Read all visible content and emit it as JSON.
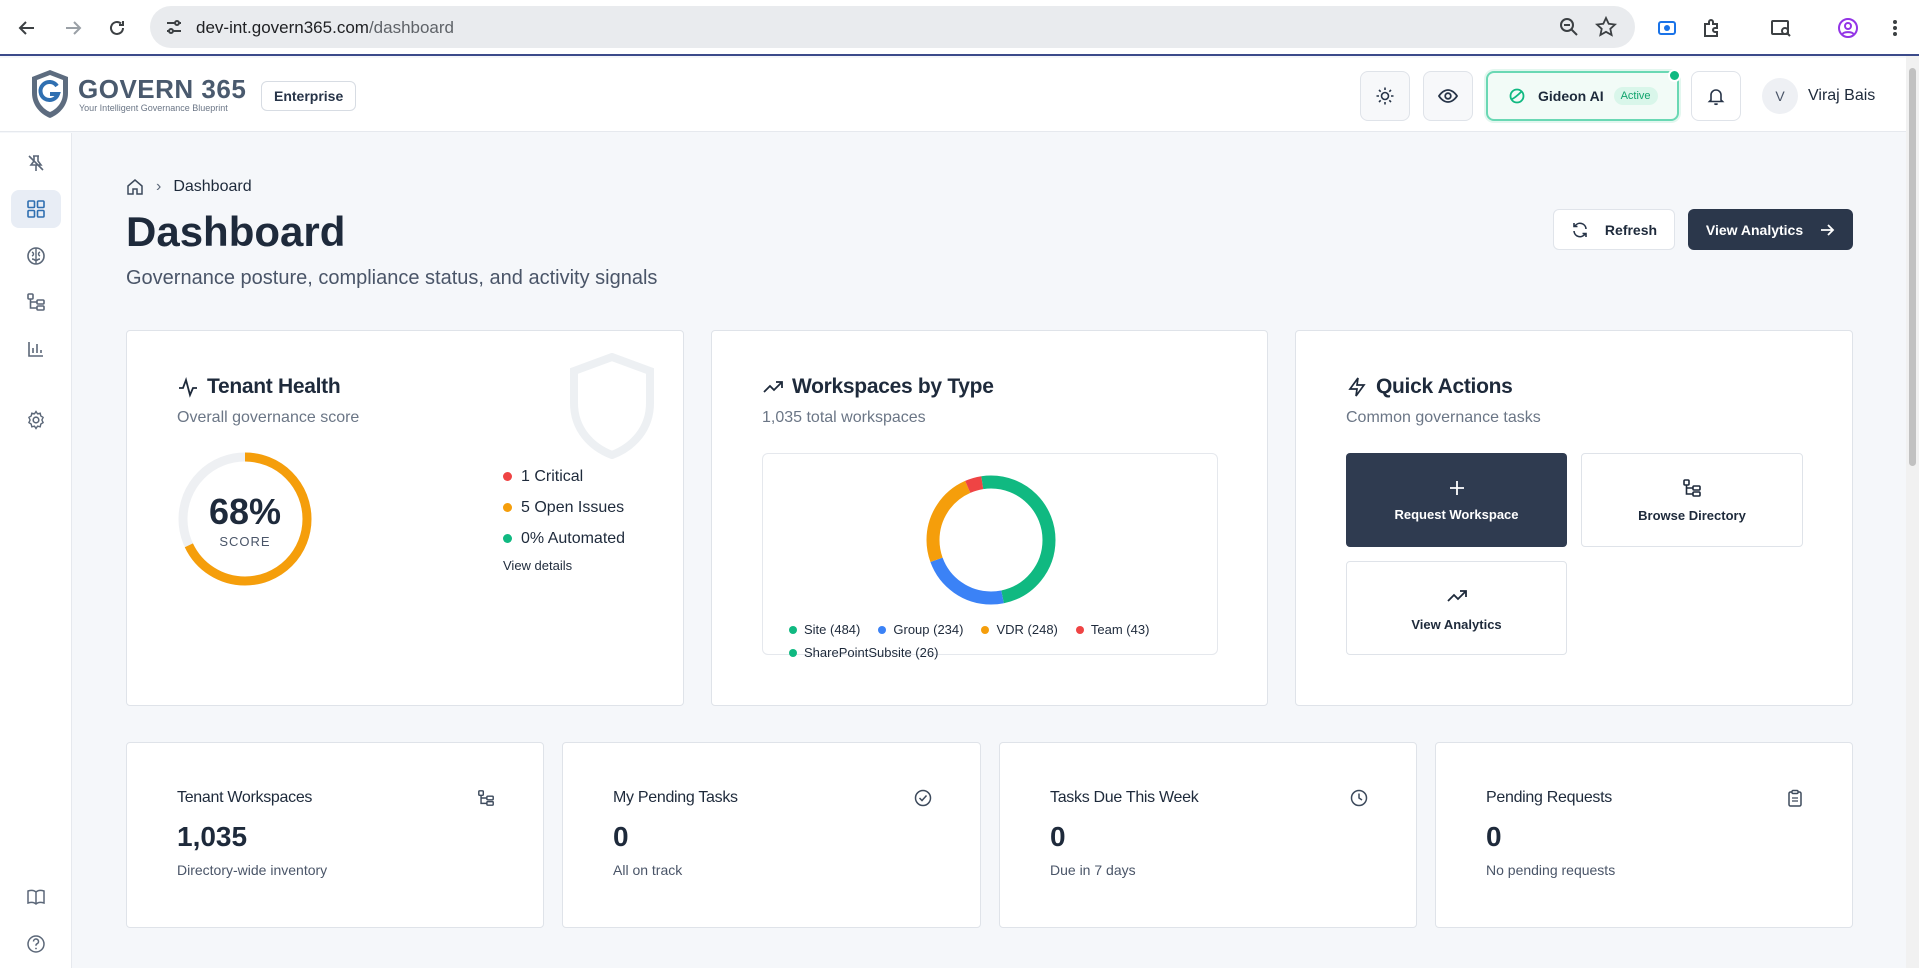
{
  "browser": {
    "url_host": "dev-int.govern365.com",
    "url_path": "/dashboard"
  },
  "header": {
    "brand": "GOVERN 365",
    "tagline": "Your Intelligent Governance Blueprint",
    "plan": "Enterprise",
    "assistant_name": "Gideon AI",
    "assistant_status": "Active",
    "user_initial": "V",
    "user_name": "Viraj Bais"
  },
  "sidebar": {
    "items": [
      {
        "icon": "pin-off-icon"
      },
      {
        "icon": "dashboard-grid-icon",
        "active": true
      },
      {
        "icon": "brain-icon"
      },
      {
        "icon": "directory-tree-icon"
      },
      {
        "icon": "bar-chart-icon"
      },
      {
        "icon": "gear-icon"
      },
      {
        "icon": "book-icon"
      },
      {
        "icon": "help-circle-icon"
      }
    ]
  },
  "page": {
    "breadcrumb_current": "Dashboard",
    "title": "Dashboard",
    "subtitle": "Governance posture, compliance status, and activity signals",
    "refresh_label": "Refresh",
    "analytics_label": "View Analytics"
  },
  "tenant_health": {
    "title": "Tenant Health",
    "subtitle": "Overall governance score",
    "score_text": "68%",
    "score_value": 0.68,
    "score_label": "SCORE",
    "items": [
      {
        "text": "1 Critical",
        "color": "#ef4444"
      },
      {
        "text": "5 Open Issues",
        "color": "#f59e0b"
      },
      {
        "text": "0% Automated",
        "color": "#10b981"
      }
    ],
    "view_details": "View details",
    "accent": "#f59e0b"
  },
  "workspaces": {
    "title": "Workspaces by Type",
    "subtitle": "1,035 total workspaces"
  },
  "chart_data": {
    "type": "pie",
    "donut": true,
    "categories": [
      "Site",
      "Group",
      "VDR",
      "Team",
      "SharePointSubsite"
    ],
    "values": [
      484,
      234,
      248,
      43,
      26
    ],
    "colors": [
      "#10b981",
      "#3b82f6",
      "#f59e0b",
      "#ef4444",
      "#10b981"
    ],
    "legend_labels": [
      "Site (484)",
      "Group (234)",
      "VDR (248)",
      "Team (43)",
      "SharePointSubsite (26)"
    ],
    "legend": "bottom"
  },
  "quick_actions": {
    "title": "Quick Actions",
    "subtitle": "Common governance tasks",
    "actions": [
      {
        "label": "Request Workspace"
      },
      {
        "label": "Browse Directory"
      },
      {
        "label": "View Analytics"
      }
    ]
  },
  "stats": [
    {
      "title": "Tenant Workspaces",
      "value": "1,035",
      "note": "Directory-wide inventory",
      "icon": "directory-tree-icon"
    },
    {
      "title": "My Pending Tasks",
      "value": "0",
      "note": "All on track",
      "icon": "check-circle-icon"
    },
    {
      "title": "Tasks Due This Week",
      "value": "0",
      "note": "Due in 7 days",
      "icon": "clock-icon"
    },
    {
      "title": "Pending Requests",
      "value": "0",
      "note": "No pending requests",
      "icon": "clipboard-icon"
    }
  ]
}
